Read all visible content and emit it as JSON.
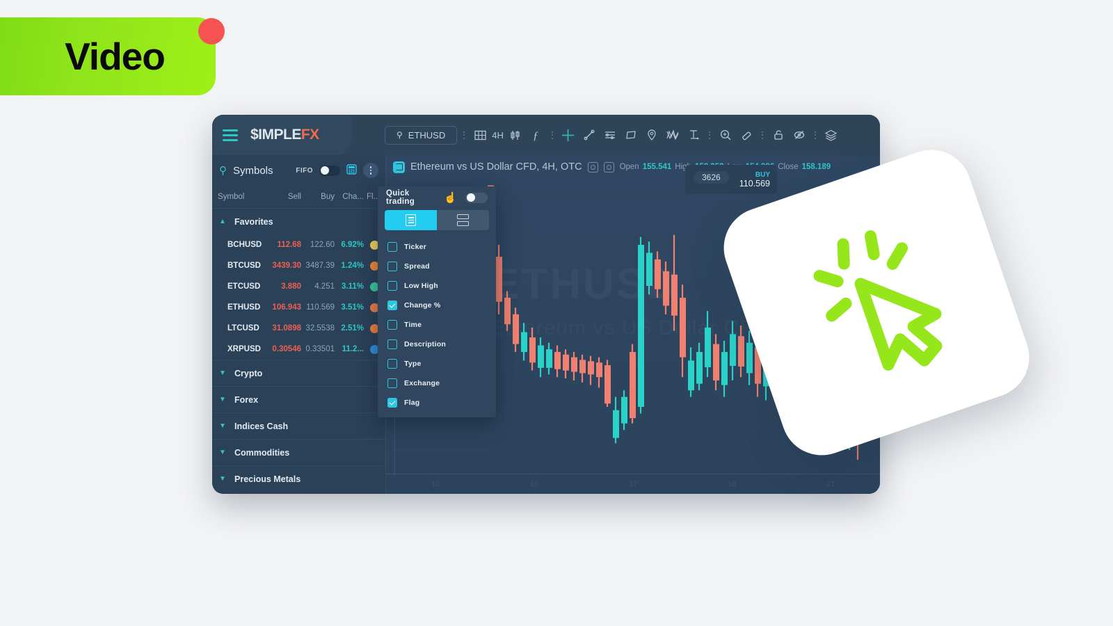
{
  "badge": {
    "label": "Video",
    "color": "#9ef018",
    "dot_color": "#f75252"
  },
  "app": {
    "logo_part1": "$IMPLE",
    "logo_part2": "FX",
    "menu_icon": "hamburger-icon"
  },
  "toolbar": {
    "symbol_search": "ETHUSD",
    "search_icon": "search-icon",
    "layout_icon": "grid-layout-icon",
    "timeframe": "4H",
    "candles_icon": "candlestick-icon",
    "indicators_icon": "function-icon",
    "crosshair_icon": "crosshair-icon",
    "trendline_icon": "trend-line-icon",
    "levels_icon": "horizontal-levels-icon",
    "shape_icon": "rectangle-shape-icon",
    "marker_icon": "location-pin-icon",
    "pattern_icon": "elliott-wave-icon",
    "measure_icon": "measure-icon",
    "zoom_icon": "zoom-in-icon",
    "eraser_icon": "eraser-icon",
    "lock_icon": "unlock-icon",
    "hide_icon": "hide-drawings-icon",
    "layers_icon": "layers-icon"
  },
  "symbols_panel": {
    "title": "Symbols",
    "search_icon": "search-icon",
    "fifo_label": "FIFO",
    "fifo_on": false,
    "calculator_icon": "calculator-icon",
    "more_icon": "kebab-menu-icon",
    "columns": [
      "Symbol",
      "Sell",
      "Buy",
      "Cha...",
      "Fl..."
    ],
    "groups": [
      {
        "name": "Favorites",
        "expanded": true,
        "rows": [
          {
            "symbol": "BCHUSD",
            "sell": "112.68",
            "buy": "122.60",
            "change": "6.92%",
            "flag_color": "#f3d45e"
          },
          {
            "symbol": "BTCUSD",
            "sell": "3439.30",
            "buy": "3487.39",
            "change": "1.24%",
            "flag_color": "#f08a3c"
          },
          {
            "symbol": "ETCUSD",
            "sell": "3.880",
            "buy": "4.251",
            "change": "3.11%",
            "flag_color": "#3ec9a0"
          },
          {
            "symbol": "ETHUSD",
            "sell": "106.943",
            "buy": "110.569",
            "change": "3.51%",
            "flag_color": "#ef7b4a"
          },
          {
            "symbol": "LTCUSD",
            "sell": "31.0898",
            "buy": "32.5538",
            "change": "2.51%",
            "flag_color": "#f0803c"
          },
          {
            "symbol": "XRPUSD",
            "sell": "0.30546",
            "buy": "0.33501",
            "change": "11.2...",
            "flag_color": "#2f8fd8"
          }
        ]
      },
      {
        "name": "Crypto",
        "expanded": false,
        "rows": []
      },
      {
        "name": "Forex",
        "expanded": false,
        "rows": []
      },
      {
        "name": "Indices Cash",
        "expanded": false,
        "rows": []
      },
      {
        "name": "Commodities",
        "expanded": false,
        "rows": []
      },
      {
        "name": "Precious Metals",
        "expanded": false,
        "rows": []
      }
    ]
  },
  "chart": {
    "title": "Ethereum vs US Dollar CFD, 4H, OTC",
    "symbol_badge_icon": "chart-symbol-icon",
    "eye_icon_1": "visibility-icon",
    "eye_icon_2": "settings-circle-icon",
    "ohlc": {
      "open_label": "Open",
      "open": "155.541",
      "high_label": "High",
      "high": "158.958",
      "low_label": "Low",
      "low": "154.986",
      "close_label": "Close",
      "close": "158.189"
    },
    "watermark": "ETHUSD",
    "watermark_sub": "Ethereum vs US Dollar CFD",
    "buy_widget": {
      "volume": "3626",
      "label": "BUY",
      "price": "110.569"
    },
    "x_ticks": [
      "15",
      "16",
      "17",
      "18",
      "21"
    ],
    "colors": {
      "up": "#2ad3c8",
      "down": "#f0806f",
      "accent": "#2fc4e0"
    }
  },
  "quick_trading": {
    "title": "Quick trading",
    "enabled": true,
    "cursor_icon": "pointing-hand-icon",
    "views": [
      {
        "icon": "list-view-icon",
        "active": true
      },
      {
        "icon": "split-view-icon",
        "active": false
      }
    ],
    "options": [
      {
        "label": "Ticker",
        "checked": false
      },
      {
        "label": "Spread",
        "checked": false
      },
      {
        "label": "Low High",
        "checked": false
      },
      {
        "label": "Change %",
        "checked": true
      },
      {
        "label": "Time",
        "checked": false
      },
      {
        "label": "Description",
        "checked": false
      },
      {
        "label": "Type",
        "checked": false
      },
      {
        "label": "Exchange",
        "checked": false
      },
      {
        "label": "Flag",
        "checked": true
      }
    ]
  },
  "cursor_card": {
    "icon": "click-cursor-icon",
    "color": "#95e61b"
  }
}
